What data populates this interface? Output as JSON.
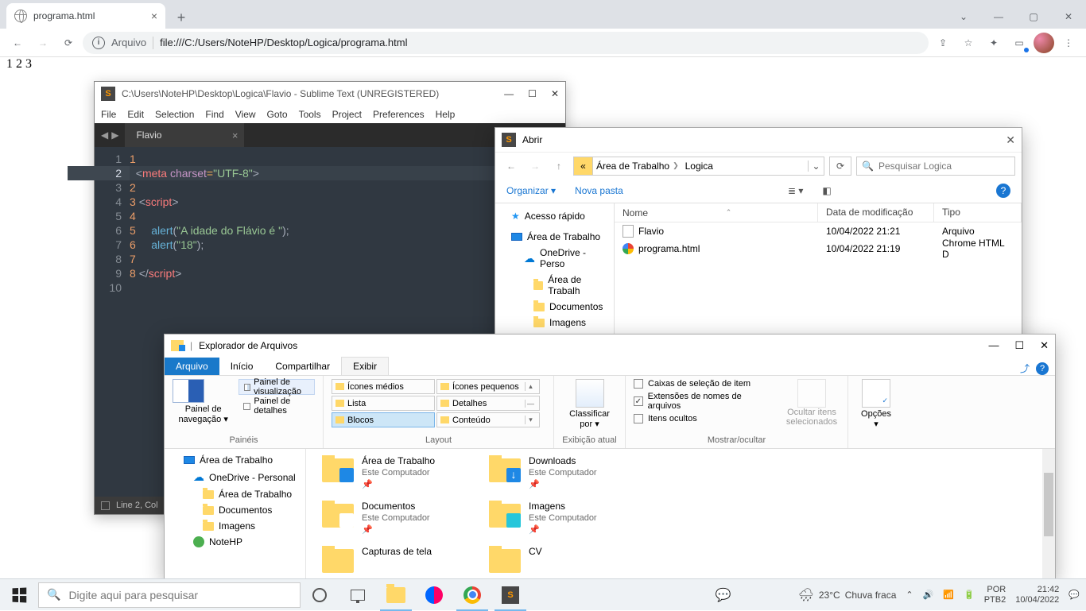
{
  "chrome": {
    "tab_title": "programa.html",
    "omnibox_prefix": "Arquivo",
    "omnibox_url": "file:///C:/Users/NoteHP/Desktop/Logica/programa.html",
    "page_text": "1 2 3"
  },
  "sublime": {
    "title": "C:\\Users\\NoteHP\\Desktop\\Logica\\Flavio - Sublime Text (UNREGISTERED)",
    "menu": [
      "File",
      "Edit",
      "Selection",
      "Find",
      "View",
      "Goto",
      "Tools",
      "Project",
      "Preferences",
      "Help"
    ],
    "tab": "Flavio",
    "status": "Line 2, Col",
    "code": {
      "l1": "1",
      "l2": {
        "tag": "meta",
        "attr": "charset",
        "op": "=",
        "str": "\"UTF-8\""
      },
      "l3": "2",
      "l4": {
        "num": "3",
        "tag": "script"
      },
      "l5": "4",
      "l6": {
        "num": "5",
        "fn": "alert",
        "str": "\"A idade do Flávio é \""
      },
      "l7": {
        "num": "6",
        "fn": "alert",
        "str": "\"18\""
      },
      "l8": "7",
      "l9": {
        "num": "8",
        "tag": "script"
      }
    }
  },
  "opendlg": {
    "title": "Abrir",
    "path": [
      "Área de Trabalho",
      "Logica"
    ],
    "search_ph": "Pesquisar Logica",
    "organize": "Organizar",
    "newfolder": "Nova pasta",
    "cols": {
      "name": "Nome",
      "date": "Data de modificação",
      "type": "Tipo"
    },
    "tree": {
      "quick": "Acesso rápido",
      "desktop": "Área de Trabalho",
      "onedrive": "OneDrive - Perso",
      "desk2": "Área de Trabalh",
      "docs": "Documentos",
      "imgs": "Imagens"
    },
    "rows": [
      {
        "name": "Flavio",
        "date": "10/04/2022 21:21",
        "type": "Arquivo",
        "icon": "file"
      },
      {
        "name": "programa.html",
        "date": "10/04/2022 21:19",
        "type": "Chrome HTML D",
        "icon": "chrome"
      }
    ]
  },
  "explorer": {
    "title": "Explorador de Arquivos",
    "tabs": {
      "file": "Arquivo",
      "home": "Início",
      "share": "Compartilhar",
      "view": "Exibir"
    },
    "ribbon": {
      "panes": {
        "nav": "Painel de navegação",
        "preview": "Painel de visualização",
        "details": "Painel de detalhes",
        "label": "Painéis"
      },
      "layout": {
        "medium": "Ícones médios",
        "small": "Ícones pequenos",
        "list": "Lista",
        "details": "Detalhes",
        "tiles": "Blocos",
        "content": "Conteúdo",
        "label": "Layout"
      },
      "current": {
        "sort": "Classificar por",
        "label": "Exibição atual"
      },
      "show": {
        "chk": "Caixas de seleção de item",
        "ext": "Extensões de nomes de arquivos",
        "hidden": "Itens ocultos",
        "hide": "Ocultar itens selecionados",
        "label": "Mostrar/ocultar"
      },
      "options": "Opções"
    },
    "tree": {
      "desktop": "Área de Trabalho",
      "onedrive": "OneDrive - Personal",
      "desk2": "Área de Trabalho",
      "docs": "Documentos",
      "imgs": "Imagens",
      "user": "NoteHP"
    },
    "tiles": [
      {
        "name": "Área de Trabalho",
        "sub": "Este Computador",
        "ov": "#1e88e5"
      },
      {
        "name": "Downloads",
        "sub": "Este Computador",
        "ov": "#1e88e5",
        "arrow": true
      },
      {
        "name": "Documentos",
        "sub": "Este Computador",
        "ov": "#fff"
      },
      {
        "name": "Imagens",
        "sub": "Este Computador",
        "ov": "#26c6da"
      },
      {
        "name": "Capturas de tela",
        "sub": ""
      },
      {
        "name": "CV",
        "sub": ""
      }
    ]
  },
  "taskbar": {
    "search_ph": "Digite aqui para pesquisar",
    "weather_temp": "23°C",
    "weather_txt": "Chuva fraca",
    "lang1": "POR",
    "lang2": "PTB2",
    "time": "21:42",
    "date": "10/04/2022"
  }
}
